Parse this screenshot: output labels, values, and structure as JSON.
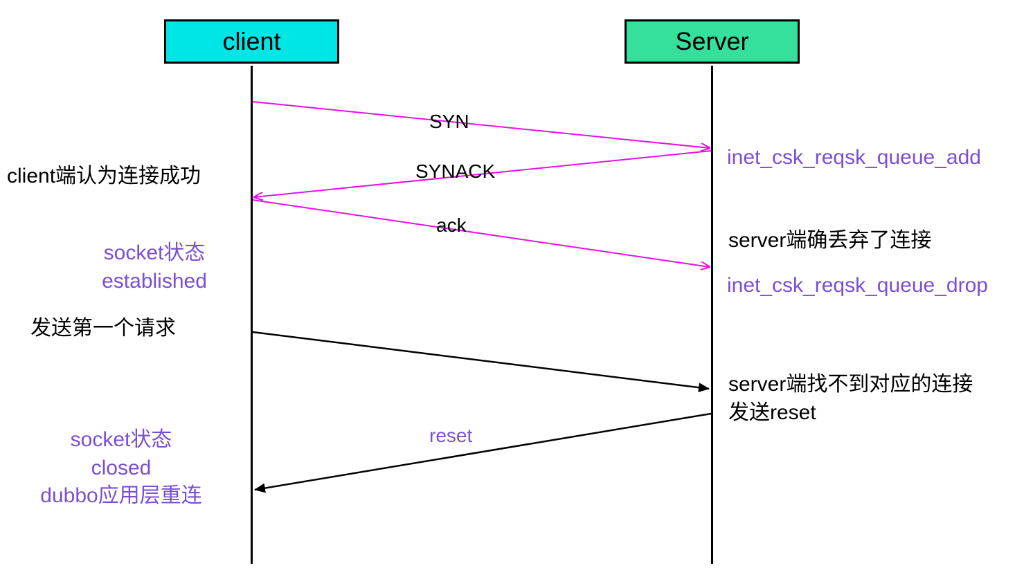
{
  "lifelines": {
    "client": "client",
    "server": "Server"
  },
  "messages": {
    "syn": "SYN",
    "synack": "SYNACK",
    "ack": "ack",
    "reset": "reset"
  },
  "client_notes": {
    "connect_success": "client端认为连接成功",
    "socket_established_line1": "socket状态",
    "socket_established_line2": "established",
    "send_first_request": "发送第一个请求",
    "socket_closed_line1": "socket状态",
    "socket_closed_line2": "closed",
    "socket_closed_line3": "dubbo应用层重连"
  },
  "server_notes": {
    "queue_add": "inet_csk_reqsk_queue_add",
    "server_dropped": "server端确丢弃了连接",
    "queue_drop": "inet_csk_reqsk_queue_drop",
    "not_found_line1": "server端找不到对应的连接",
    "not_found_line2": "发送reset"
  }
}
